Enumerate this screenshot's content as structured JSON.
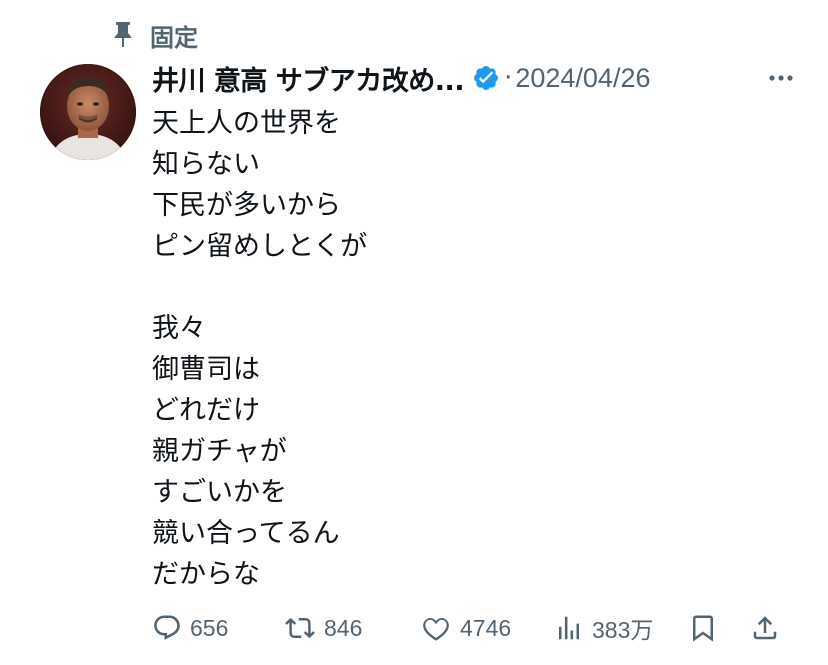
{
  "pinned": {
    "label": "固定"
  },
  "author": {
    "name": "井川 意高 サブアカ改め..."
  },
  "post": {
    "dot": "·",
    "date": "2024/04/26",
    "lines": [
      "天上人の世界を",
      "知らない",
      "下民が多いから",
      "ピン留めしとくが",
      "",
      "我々",
      "御曹司は",
      "どれだけ",
      "親ガチャが",
      "すごいかを",
      "競い合ってるん",
      "だからな"
    ]
  },
  "actions": {
    "replies": "656",
    "reposts": "846",
    "likes": "4746",
    "views": "383万"
  },
  "colors": {
    "text": "#0f1419",
    "muted": "#536471",
    "verified": "#1d9bf0"
  },
  "icons": {
    "pin": "pin-icon",
    "verified": "verified-badge-icon",
    "more": "more-icon",
    "reply": "reply-icon",
    "repost": "repost-icon",
    "like": "heart-icon",
    "views": "views-chart-icon",
    "bookmark": "bookmark-icon",
    "share": "share-icon"
  }
}
